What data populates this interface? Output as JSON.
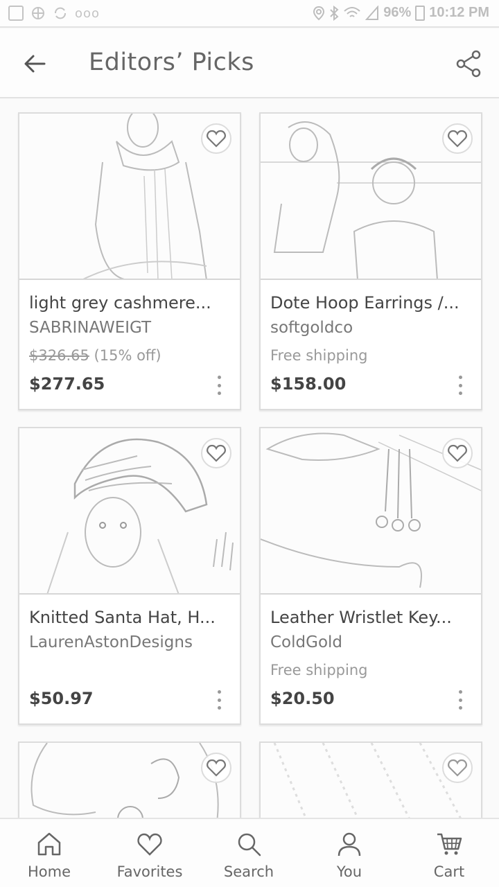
{
  "status_bar": {
    "battery": "96%",
    "time": "10:12 PM",
    "overflow": "ooo"
  },
  "toolbar": {
    "title": "Editors’ Picks"
  },
  "products": [
    {
      "title": "light grey cashmere...",
      "shop": "SABRINAWEIGT",
      "original_price": "$326.65",
      "discount": "(15% off)",
      "shipping": "",
      "price": "$277.65"
    },
    {
      "title": "Dote Hoop Earrings /...",
      "shop": "softgoldco",
      "original_price": "",
      "discount": "",
      "shipping": "Free shipping",
      "price": "$158.00"
    },
    {
      "title": "Knitted Santa Hat, H...",
      "shop": "LaurenAstonDesigns",
      "original_price": "",
      "discount": "",
      "shipping": "",
      "price": "$50.97"
    },
    {
      "title": "Leather Wristlet Key...",
      "shop": "ColdGold",
      "original_price": "",
      "discount": "",
      "shipping": "Free shipping",
      "price": "$20.50"
    }
  ],
  "nav": {
    "home": "Home",
    "favorites": "Favorites",
    "search": "Search",
    "you": "You",
    "cart": "Cart"
  },
  "colors": {
    "background": "#fafafa",
    "card": "#ffffff",
    "text": "#444444",
    "muted": "#999999",
    "border": "#dcdcdc"
  },
  "icons": [
    "back-arrow-icon",
    "share-icon",
    "heart-icon",
    "more-vert-icon",
    "home-icon",
    "heart-outline-icon",
    "search-icon",
    "person-icon",
    "cart-icon"
  ]
}
